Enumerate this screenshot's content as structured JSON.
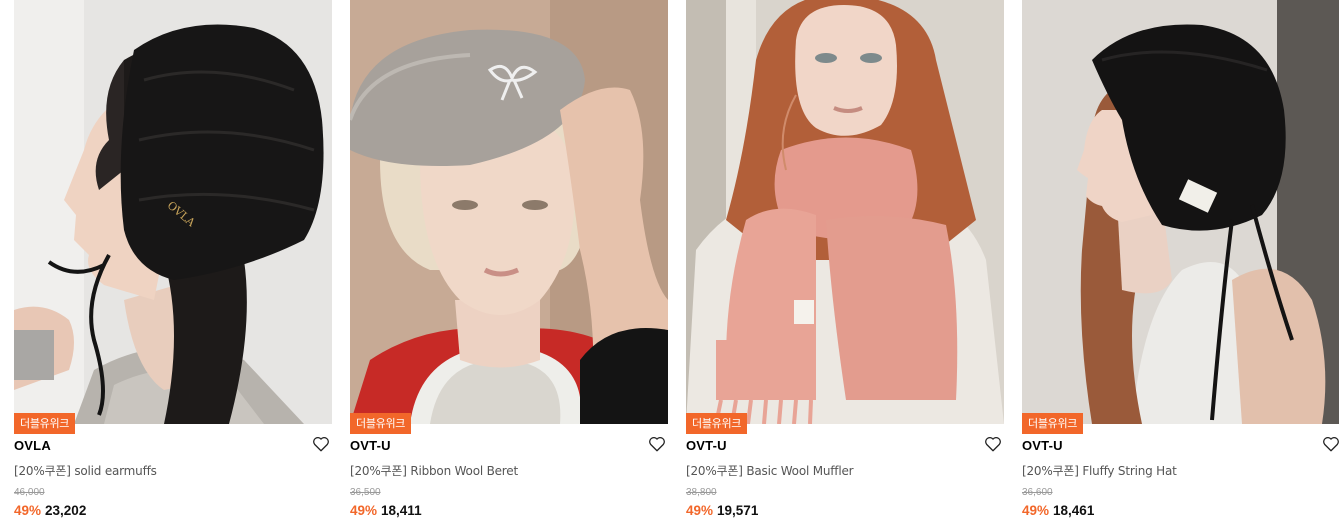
{
  "products": [
    {
      "badge": "더블유위크",
      "brand": "OVLA",
      "title": "[20%쿠폰] solid earmuffs",
      "original_price": "46,000",
      "discount": "49%",
      "sale_price": "23,202",
      "image_text": "OVLA",
      "wishlist_icon": "heart-outline-icon"
    },
    {
      "badge": "더블유위크",
      "brand": "OVT-U",
      "title": "[20%쿠폰] Ribbon Wool Beret",
      "original_price": "36,500",
      "discount": "49%",
      "sale_price": "18,411",
      "wishlist_icon": "heart-outline-icon"
    },
    {
      "badge": "더블유위크",
      "brand": "OVT-U",
      "title": "[20%쿠폰] Basic Wool Muffler",
      "original_price": "38,800",
      "discount": "49%",
      "sale_price": "19,571",
      "wishlist_icon": "heart-outline-icon"
    },
    {
      "badge": "더블유위크",
      "brand": "OVT-U",
      "title": "[20%쿠폰] Fluffy String Hat",
      "original_price": "36,600",
      "discount": "49%",
      "sale_price": "18,461",
      "wishlist_icon": "heart-outline-icon"
    }
  ],
  "colors": {
    "accent": "#f2672a",
    "text": "#111111",
    "muted": "#9a9a9a"
  }
}
